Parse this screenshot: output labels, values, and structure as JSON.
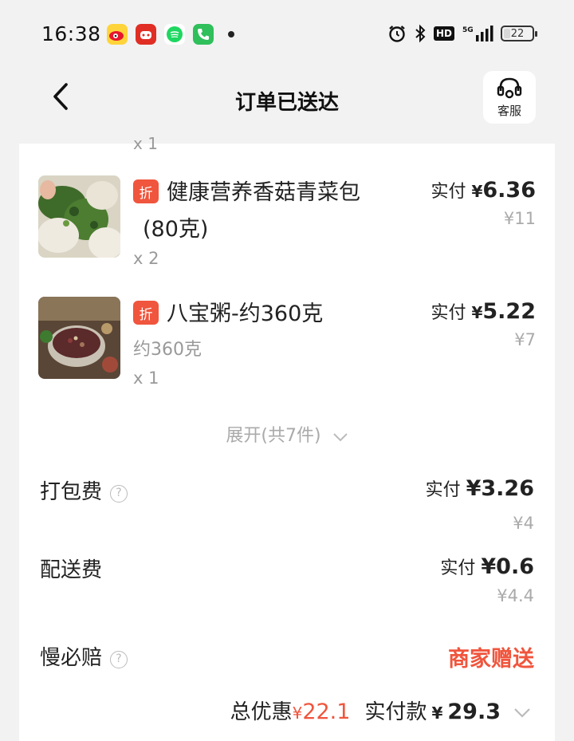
{
  "status_bar": {
    "time": "16:38",
    "battery": "22",
    "network": "5G",
    "hd": "HD"
  },
  "nav": {
    "title": "订单已送达",
    "service_label": "客服"
  },
  "items": [
    {
      "tag": "折",
      "name_line1": "健康营养香菇青菜包",
      "name_line2": "(80克)",
      "qty": "x 2",
      "paid_label": "实付",
      "paid_yen": "¥",
      "paid_amount": "6.36",
      "original": "¥11"
    },
    {
      "tag": "折",
      "name_line1": "八宝粥-约360克",
      "sub": "约360克",
      "qty": "x 1",
      "paid_label": "实付",
      "paid_yen": "¥",
      "paid_amount": "5.22",
      "original": "¥7"
    }
  ],
  "expand_label": "展开(共7件)",
  "fees": {
    "packing": {
      "label": "打包费",
      "paid_label": "实付",
      "amount": "¥3.26",
      "original": "¥4"
    },
    "delivery": {
      "label": "配送费",
      "paid_label": "实付",
      "amount": "¥0.6",
      "original": "¥4.4"
    },
    "late": {
      "label": "慢必赔",
      "value": "商家赠送"
    }
  },
  "totals": {
    "discount_label": "总优惠",
    "discount_yen": "¥",
    "discount_value": "22.1",
    "pay_label": "实付款",
    "pay_yen": "¥",
    "pay_value": "29.3"
  },
  "colors": {
    "accent": "#f0553d",
    "background": "#f2f2f2",
    "card": "#ffffff"
  }
}
